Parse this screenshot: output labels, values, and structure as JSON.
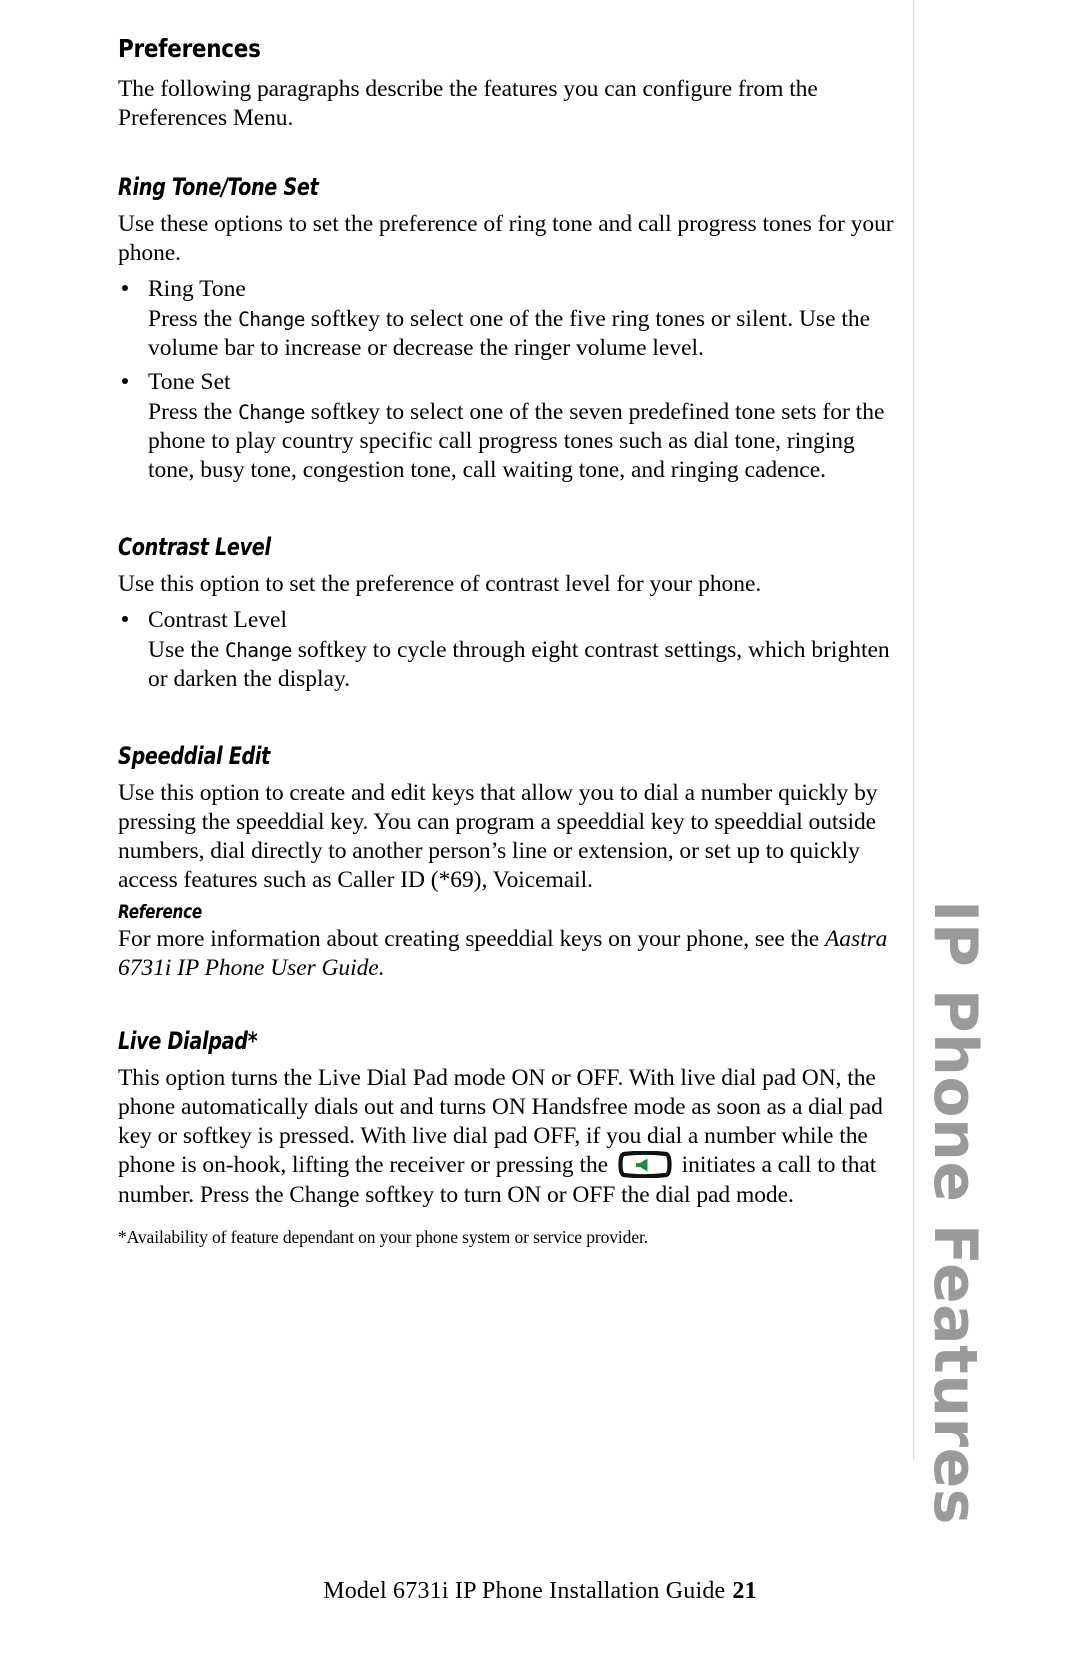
{
  "document": {
    "title": "Preferences",
    "footer_text": "Model 6731i IP Phone Installation Guide",
    "footer_page_number": "21",
    "side_tab": "IP Phone Features"
  },
  "intro": {
    "paragraph": "The following paragraphs describe the features you can configure from the Preferences Menu."
  },
  "sections": {
    "ring_tone": {
      "heading": "Ring Tone/Tone Set",
      "intro": "Use these options to set the preference of ring tone and call progress tones for your phone.",
      "bullets": [
        {
          "label": "Ring Tone",
          "body_pre": "Press the ",
          "softkey": "Change",
          "body_post": " softkey to select one of the five ring tones or silent. Use the volume bar to increase or decrease the ringer volume level."
        },
        {
          "label": "Tone Set",
          "body_pre": "Press the ",
          "softkey": "Change",
          "body_post": " softkey to select one of the seven predefined tone sets for the phone to play country specific call progress tones such as dial tone, ringing tone, busy tone, congestion tone, call waiting tone, and ringing cadence."
        }
      ]
    },
    "contrast_level": {
      "heading": "Contrast Level",
      "intro": "Use this option to set the preference of contrast level for your phone.",
      "bullets": [
        {
          "label": "Contrast Level",
          "body_pre": "Use the ",
          "softkey": "Change",
          "body_post": " softkey to cycle through eight contrast settings, which brighten or darken the display."
        }
      ]
    },
    "speeddial_edit": {
      "heading": "Speeddial Edit",
      "paragraph": "Use this option to create and edit keys that allow you to dial a number quickly by pressing the speeddial key. You can program a speeddial key to speeddial outside numbers, dial directly to another person’s line or extension, or set up to quickly access features such as Caller ID (*69), Voicemail.",
      "reference_heading": "Reference",
      "reference_text": "For more information about creating speeddial keys on your phone, see the ",
      "reference_title": "Aastra 6731i IP Phone User Guide."
    },
    "live_dialpad": {
      "heading": "Live Dialpad*",
      "paragraph_part1": "This option turns the Live Dial Pad mode ON or OFF. With live dial pad ON, the phone automatically dials out and turns ON Handsfree mode as soon as a dial pad key or softkey is pressed. With live dial pad OFF, if you dial a number while the phone is on-hook, lifting the receiver or pressing the ",
      "key_icon_name": "handsfree-speaker-key",
      "paragraph_part2": " initiates a call to that number. Press the ",
      "softkey": "Change",
      "paragraph_part3": " softkey to turn ON or OFF the dial pad mode.",
      "footnote": "*Availability of feature dependant on your phone system or service provider."
    }
  },
  "colors": {
    "text": "#000000",
    "side_tab": "#9a9a9a",
    "key_icon_accent": "#1f8a3b",
    "rule": "#d9d9d9"
  }
}
